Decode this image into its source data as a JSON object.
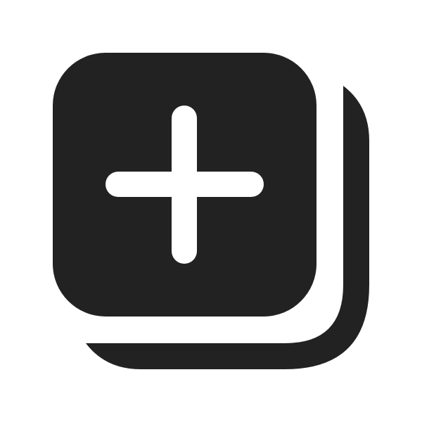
{
  "icon": {
    "name": "add-square-multiple-icon",
    "fill_color": "#222222",
    "plus_color": "#ffffff",
    "background_color": "#ffffff"
  }
}
